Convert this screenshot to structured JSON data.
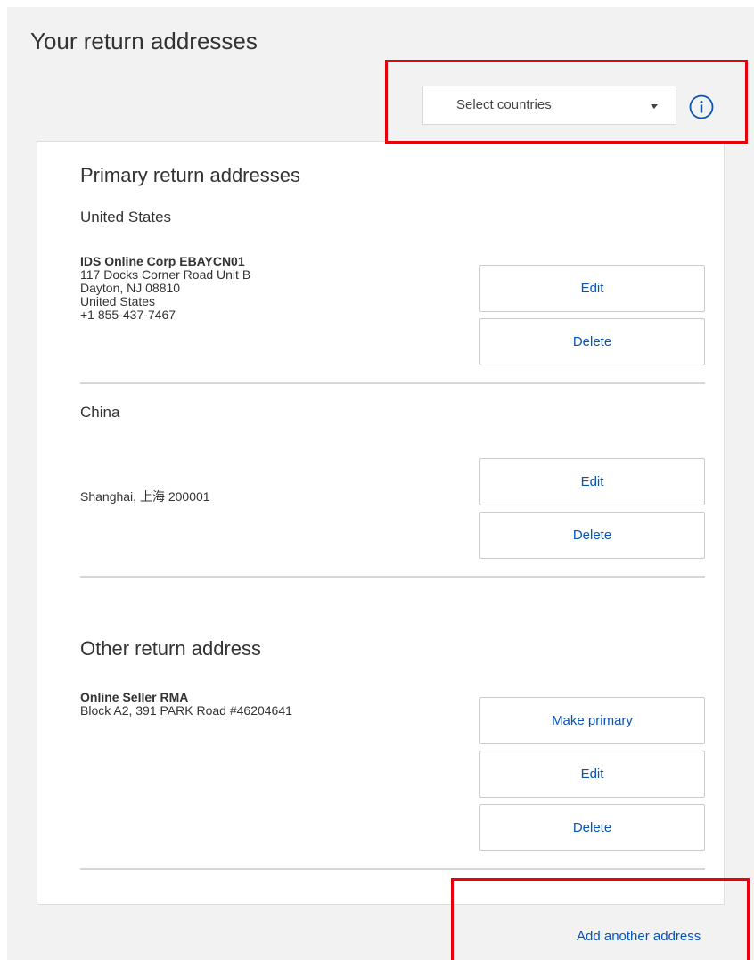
{
  "page": {
    "title": "Your return addresses"
  },
  "filter": {
    "country_select_label": "Select countries",
    "info_icon": "info-circle-icon"
  },
  "primary": {
    "heading": "Primary return addresses",
    "addresses": [
      {
        "country": "United States",
        "name": "IDS Online Corp EBAYCN01",
        "line1": "117 Docks Corner Road Unit B",
        "line2": "Dayton, NJ 08810",
        "line3": "United States",
        "phone": "+1 855-437-7467",
        "edit_label": "Edit",
        "delete_label": "Delete"
      },
      {
        "country": "China",
        "line1": "Shanghai, 上海 200001",
        "edit_label": "Edit",
        "delete_label": "Delete"
      }
    ]
  },
  "other": {
    "heading": "Other return address",
    "addresses": [
      {
        "name": "Online Seller RMA",
        "line1": "Block A2, 391 PARK Road #46204641",
        "make_primary_label": "Make primary",
        "edit_label": "Edit",
        "delete_label": "Delete"
      }
    ]
  },
  "footer": {
    "add_address_label": "Add another address"
  },
  "colors": {
    "link_blue": "#0654ba",
    "highlight_red": "#e8000b",
    "page_background": "#f2f2f2",
    "divider": "#d6d6d6"
  }
}
